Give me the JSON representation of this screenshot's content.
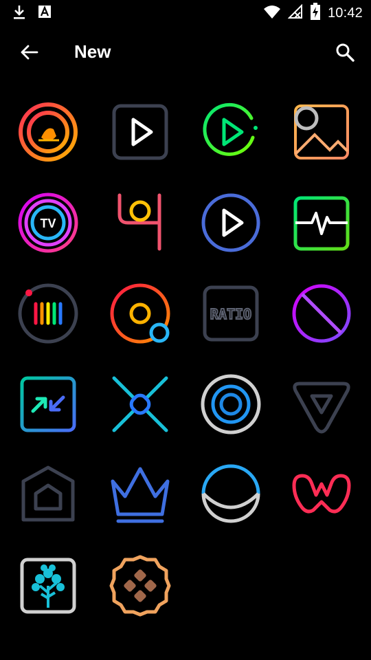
{
  "status_bar": {
    "time": "10:42",
    "icons": [
      "download-icon",
      "font-a-icon",
      "wifi-icon",
      "no-signal-icon",
      "battery-charging-icon"
    ]
  },
  "app_bar": {
    "title": "New",
    "back_icon": "arrow-back-icon",
    "search_icon": "search-icon"
  },
  "icons_grid": [
    {
      "name": "circle-logo-orange-icon"
    },
    {
      "name": "play-square-icon"
    },
    {
      "name": "play-circle-green-icon"
    },
    {
      "name": "gallery-image-icon"
    },
    {
      "name": "tv-circle-icon",
      "label": "TV"
    },
    {
      "name": "hook-symbol-icon"
    },
    {
      "name": "play-circle-blue-icon"
    },
    {
      "name": "pulse-monitor-icon"
    },
    {
      "name": "equalizer-circle-icon"
    },
    {
      "name": "disc-target-icon"
    },
    {
      "name": "ratio-icon",
      "label": "RATIO"
    },
    {
      "name": "no-symbol-icon"
    },
    {
      "name": "resize-arrows-icon"
    },
    {
      "name": "cross-link-icon"
    },
    {
      "name": "concentric-rings-icon"
    },
    {
      "name": "triangle-shield-icon"
    },
    {
      "name": "home-hexagon-icon"
    },
    {
      "name": "crown-icon"
    },
    {
      "name": "moon-circle-icon"
    },
    {
      "name": "letter-w-icon"
    },
    {
      "name": "tree-square-icon"
    },
    {
      "name": "cookie-gamepad-icon"
    }
  ]
}
